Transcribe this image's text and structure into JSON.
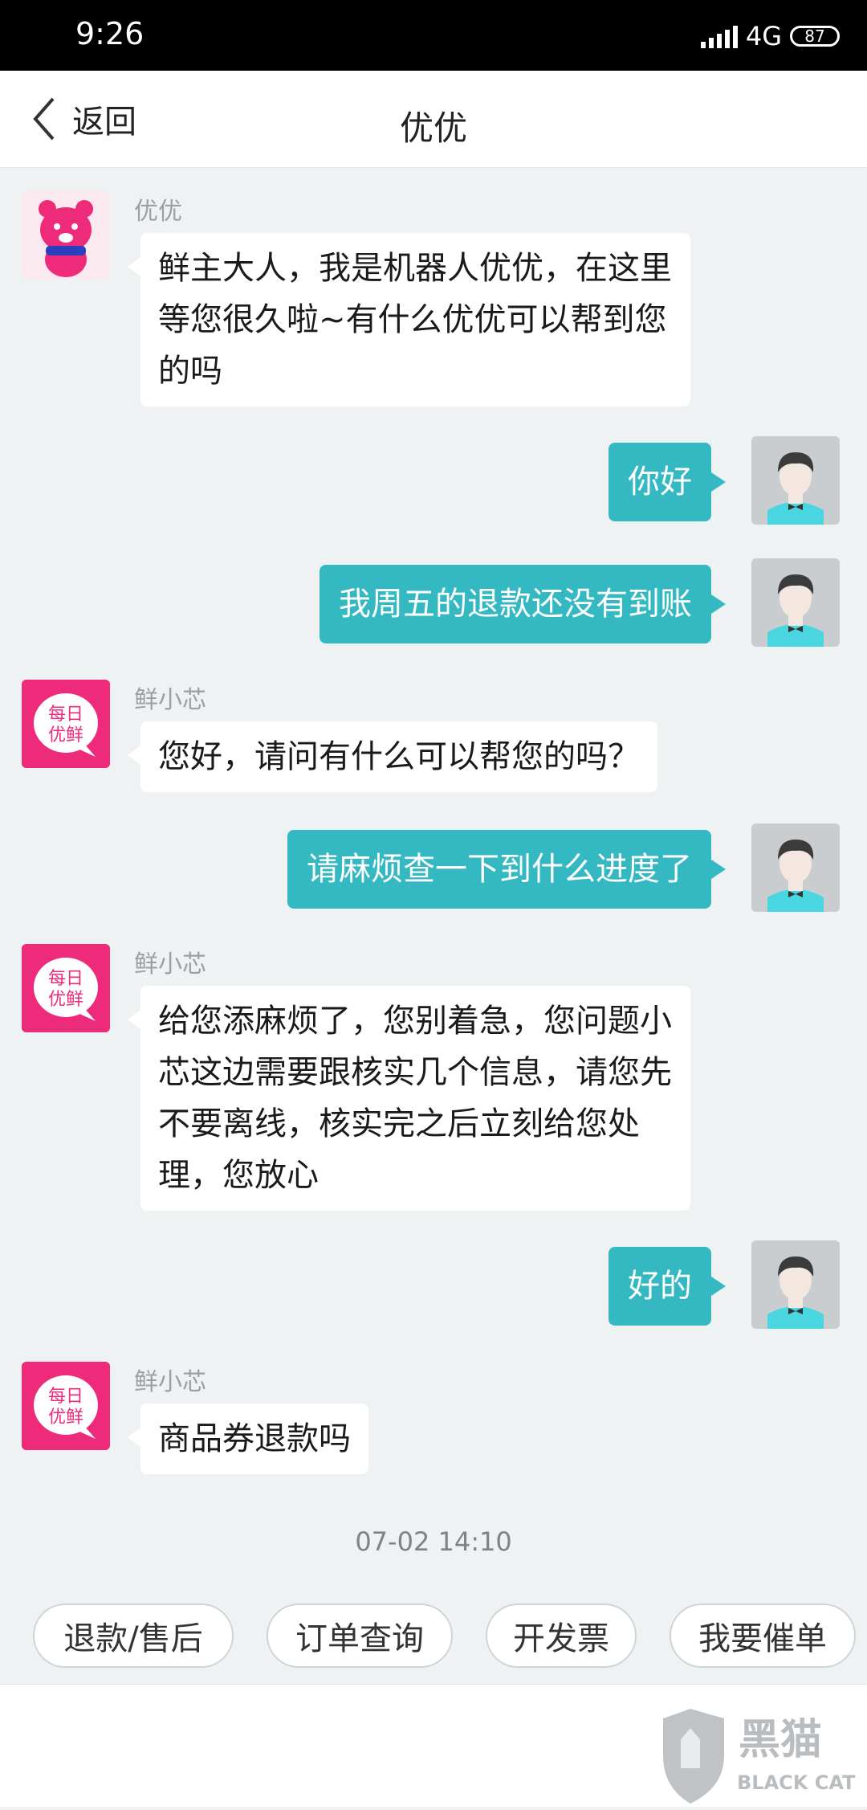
{
  "status_bar": {
    "time": "9:26",
    "network": "4G",
    "battery": "87"
  },
  "nav": {
    "back_label": "返回",
    "title": "优优"
  },
  "messages": [
    {
      "side": "left",
      "avatar": "pink-bear-avatar",
      "sender": "优优",
      "text": "鲜主大人，我是机器人优优，在这里等您很久啦~有什么优优可以帮到您的吗"
    },
    {
      "side": "right",
      "avatar": "user-avatar",
      "text": "你好"
    },
    {
      "side": "right",
      "avatar": "user-avatar",
      "text": "我周五的退款还没有到账"
    },
    {
      "side": "left",
      "avatar": "meiri-youxian-logo",
      "sender": "鲜小芯",
      "text": "您好，请问有什么可以帮您的吗？"
    },
    {
      "side": "right",
      "avatar": "user-avatar",
      "text": "请麻烦查一下到什么进度了"
    },
    {
      "side": "left",
      "avatar": "meiri-youxian-logo",
      "sender": "鲜小芯",
      "text": "给您添麻烦了，您别着急，您问题小芯这边需要跟核实几个信息，请您先不要离线，核实完之后立刻给您处理，您放心"
    },
    {
      "side": "right",
      "avatar": "user-avatar",
      "text": "好的"
    },
    {
      "side": "left",
      "avatar": "meiri-youxian-logo",
      "sender": "鲜小芯",
      "text": "商品券退款吗"
    }
  ],
  "logo_text": "每日优鲜",
  "timestamp": "07-02 14:10",
  "quick_actions": [
    "退款/售后",
    "订单查询",
    "开发票",
    "我要催单"
  ],
  "watermark": {
    "brand": "黑猫",
    "brand_en": "BLACK CAT"
  },
  "colors": {
    "user_bubble": "#34b8c2",
    "brand_pink": "#ee2a7b",
    "background": "#eef2f3"
  }
}
